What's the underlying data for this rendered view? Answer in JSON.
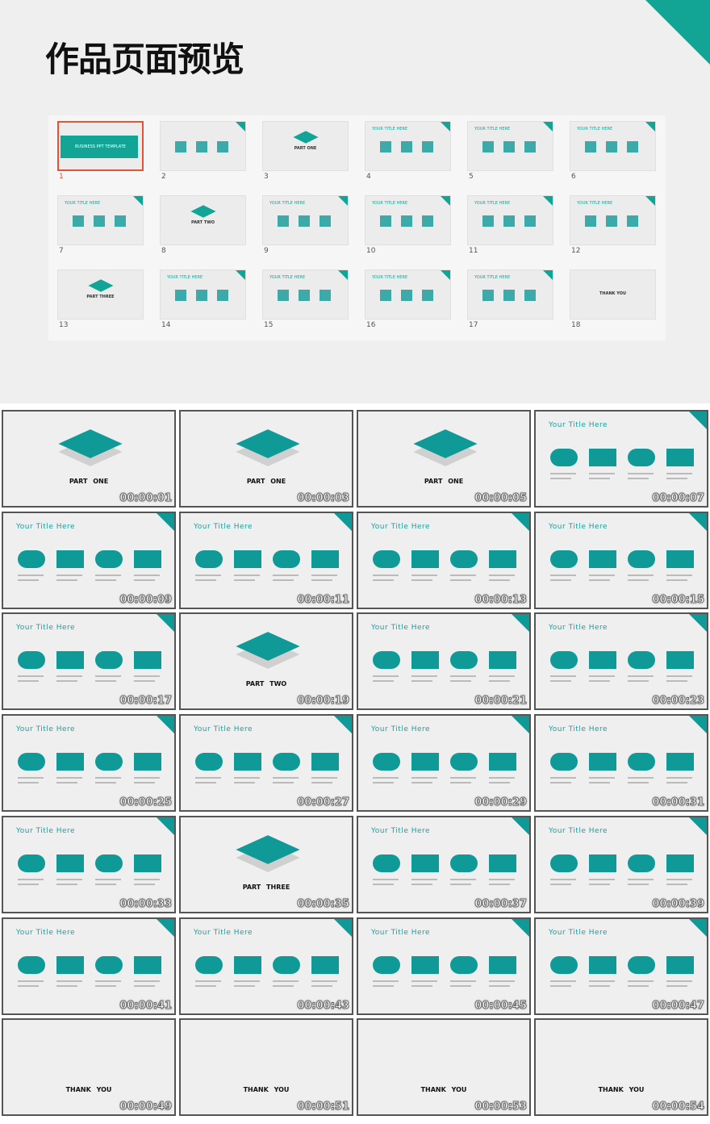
{
  "header": {
    "title": "作品页面预览",
    "accent": "#12a596"
  },
  "thumbnails": [
    {
      "n": "1",
      "type": "band",
      "text": "BUSINESS PPT TEMPLATE",
      "selected": true
    },
    {
      "n": "2",
      "type": "content",
      "text": ""
    },
    {
      "n": "3",
      "type": "part",
      "text": "PART ONE"
    },
    {
      "n": "4",
      "type": "content",
      "text": "YOUR TITLE HERE"
    },
    {
      "n": "5",
      "type": "content",
      "text": "YOUR TITLE HERE"
    },
    {
      "n": "6",
      "type": "content",
      "text": "YOUR TITLE HERE"
    },
    {
      "n": "7",
      "type": "content",
      "text": "YOUR TITLE HERE"
    },
    {
      "n": "8",
      "type": "part",
      "text": "PART TWO"
    },
    {
      "n": "9",
      "type": "content",
      "text": "YOUR TITLE HERE"
    },
    {
      "n": "10",
      "type": "content",
      "text": "YOUR TITLE HERE"
    },
    {
      "n": "11",
      "type": "content",
      "text": "YOUR TITLE HERE"
    },
    {
      "n": "12",
      "type": "content",
      "text": "YOUR TITLE HERE"
    },
    {
      "n": "13",
      "type": "part",
      "text": "PART THREE"
    },
    {
      "n": "14",
      "type": "content",
      "text": "YOUR TITLE HERE"
    },
    {
      "n": "15",
      "type": "content",
      "text": "YOUR TITLE HERE"
    },
    {
      "n": "16",
      "type": "content",
      "text": "YOUR TITLE HERE"
    },
    {
      "n": "17",
      "type": "content",
      "text": "YOUR TITLE HERE"
    },
    {
      "n": "18",
      "type": "thanks",
      "text": "THANK YOU"
    }
  ],
  "frames": [
    {
      "type": "part",
      "text": "PART ONE",
      "time": "00:00:01"
    },
    {
      "type": "part",
      "text": "PART ONE",
      "time": "00:00:03"
    },
    {
      "type": "part",
      "text": "PART ONE",
      "time": "00:00:05"
    },
    {
      "type": "content",
      "text": "Your Title Here",
      "time": "00:00:07"
    },
    {
      "type": "content",
      "text": "Your Title Here",
      "time": "00:00:09"
    },
    {
      "type": "content",
      "text": "Your Title Here",
      "time": "00:00:11"
    },
    {
      "type": "content",
      "text": "Your Title Here",
      "time": "00:00:13"
    },
    {
      "type": "content",
      "text": "Your Title Here",
      "time": "00:00:15"
    },
    {
      "type": "content",
      "text": "Your Title Here",
      "time": "00:00:17"
    },
    {
      "type": "part",
      "text": "PART TWO",
      "time": "00:00:19"
    },
    {
      "type": "content",
      "text": "Your Title Here",
      "time": "00:00:21"
    },
    {
      "type": "content",
      "text": "Your Title Here",
      "time": "00:00:23"
    },
    {
      "type": "content",
      "text": "Your Title Here",
      "time": "00:00:25"
    },
    {
      "type": "content",
      "text": "Your Title Here",
      "time": "00:00:27"
    },
    {
      "type": "content",
      "text": "Your Title Here",
      "time": "00:00:29"
    },
    {
      "type": "content",
      "text": "Your Title Here",
      "time": "00:00:31"
    },
    {
      "type": "content",
      "text": "Your Title Here",
      "time": "00:00:33"
    },
    {
      "type": "part",
      "text": "PART THREE",
      "time": "00:00:35"
    },
    {
      "type": "content",
      "text": "Your Title Here",
      "time": "00:00:37"
    },
    {
      "type": "content",
      "text": "Your Title Here",
      "time": "00:00:39"
    },
    {
      "type": "content",
      "text": "Your Title Here",
      "time": "00:00:41"
    },
    {
      "type": "content",
      "text": "Your Title Here",
      "time": "00:00:43"
    },
    {
      "type": "content",
      "text": "Your Title Here",
      "time": "00:00:45"
    },
    {
      "type": "content",
      "text": "Your Title Here",
      "time": "00:00:47"
    },
    {
      "type": "thanks",
      "text": "THANK YOU",
      "time": "00:00:49"
    },
    {
      "type": "thanks",
      "text": "THANK YOU",
      "time": "00:00:51"
    },
    {
      "type": "thanks",
      "text": "THANK YOU",
      "time": "00:00:53"
    },
    {
      "type": "thanks",
      "text": "THANK YOU",
      "time": "00:00:54"
    }
  ]
}
